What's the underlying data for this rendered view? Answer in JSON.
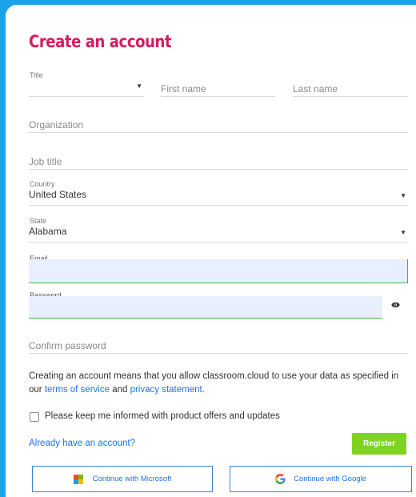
{
  "page": {
    "title": "Create an account"
  },
  "form": {
    "title_field": {
      "label": "Title",
      "value": ""
    },
    "first_name": {
      "placeholder": "First name"
    },
    "last_name": {
      "placeholder": "Last name"
    },
    "organization": {
      "placeholder": "Organization"
    },
    "job_title": {
      "placeholder": "Job title"
    },
    "country": {
      "label": "Country",
      "value": "United States"
    },
    "state": {
      "label": "State",
      "value": "Alabama"
    },
    "email": {
      "label": "Email",
      "value": ""
    },
    "password": {
      "label": "Password",
      "value": ""
    },
    "confirm_password": {
      "placeholder": "Confirm password"
    }
  },
  "legal": {
    "text_before": "Creating an account means that you allow classroom.cloud to use your data as specified in our ",
    "terms_link": "terms of service",
    "text_middle": " and ",
    "privacy_link": "privacy statement",
    "text_after": "."
  },
  "newsletter": {
    "label": "Please keep me informed with product offers and updates",
    "checked": false
  },
  "actions": {
    "signin_link": "Already have an account?",
    "register_label": "Register",
    "microsoft_label": "Continue with Microsoft",
    "google_label": "Continue with Google"
  },
  "icons": {
    "dropdown": "dropdown-arrow-icon",
    "eye": "eye-icon",
    "microsoft": "microsoft-logo-icon",
    "google": "google-logo-icon"
  },
  "colors": {
    "accent_frame": "#1aa3e8",
    "title": "#d81b60",
    "link": "#1a73e8",
    "register": "#7ed321",
    "valid_border": "#3bb54a",
    "autofill_bg": "#e8f0fe"
  }
}
